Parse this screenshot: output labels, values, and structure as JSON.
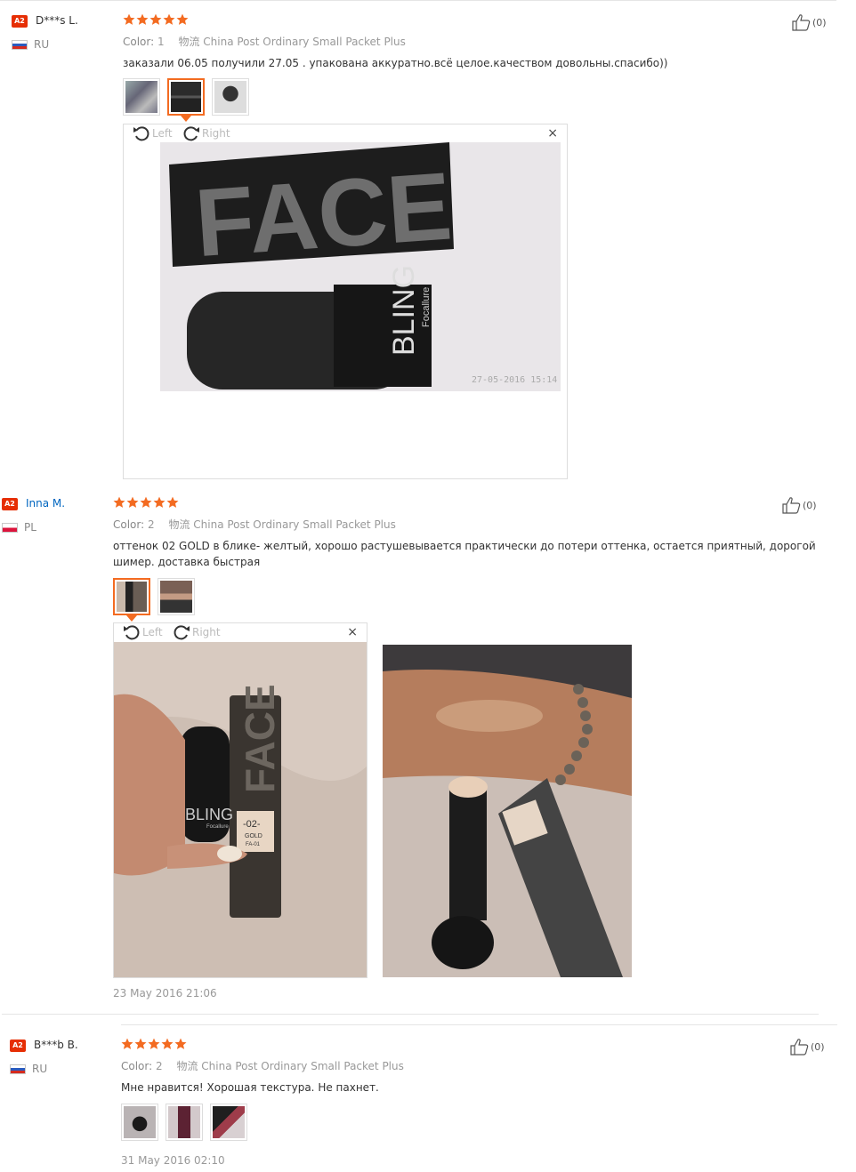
{
  "reviews": [
    {
      "badge": "A2",
      "user": "D***s L.",
      "country": "RU",
      "color_label": "Color:",
      "color_value": "1",
      "shipping": "物流 China Post Ordinary Small Packet Plus",
      "text": "заказали 06.05 получили 27.05 . упакована аккуратно.всё целое.качеством довольны.спасибо))",
      "likes": "(0)",
      "viewer": {
        "left": "Left",
        "right": "Right",
        "close": "×",
        "photo_text": "FACE",
        "photo_text2": "BLING",
        "photo_brand": "Focallure",
        "photo_stamp": "27-05-2016 15:14"
      }
    },
    {
      "badge": "A2",
      "user": "Inna M.",
      "country": "PL",
      "color_label": "Color:",
      "color_value": "2",
      "shipping": "物流 China Post Ordinary Small Packet Plus",
      "text": "оттенок 02 GOLD в блике- желтый, хорошо растушевывается практически до потери оттенка, остается приятный, дорогой шимер. доставка быстрая",
      "likes": "(0)",
      "viewer": {
        "left": "Left",
        "right": "Right",
        "close": "×",
        "photo_text": "FACE",
        "photo_text2": "BLING",
        "photo_brand": "Focallure",
        "shade": "-02-",
        "shade_name": "GOLD",
        "shade_code": "FA-01"
      },
      "date": "23 May 2016 21:06"
    },
    {
      "badge": "A2",
      "user": "B***b B.",
      "country": "RU",
      "color_label": "Color:",
      "color_value": "2",
      "shipping": "物流 China Post Ordinary Small Packet Plus",
      "text": "Мне нравится! Хорошая текстура. Не пахнет.",
      "likes": "(0)",
      "date": "31 May 2016 02:10"
    }
  ],
  "colors": {
    "accent": "#f36b21",
    "star": "#f36b21",
    "badge": "#e62e04",
    "username_link": "#0066c0"
  },
  "icons": {
    "star": "star-icon",
    "like": "thumbs-up-icon",
    "rotate_left": "rotate-left-icon",
    "rotate_right": "rotate-right-icon",
    "close": "close-icon"
  }
}
